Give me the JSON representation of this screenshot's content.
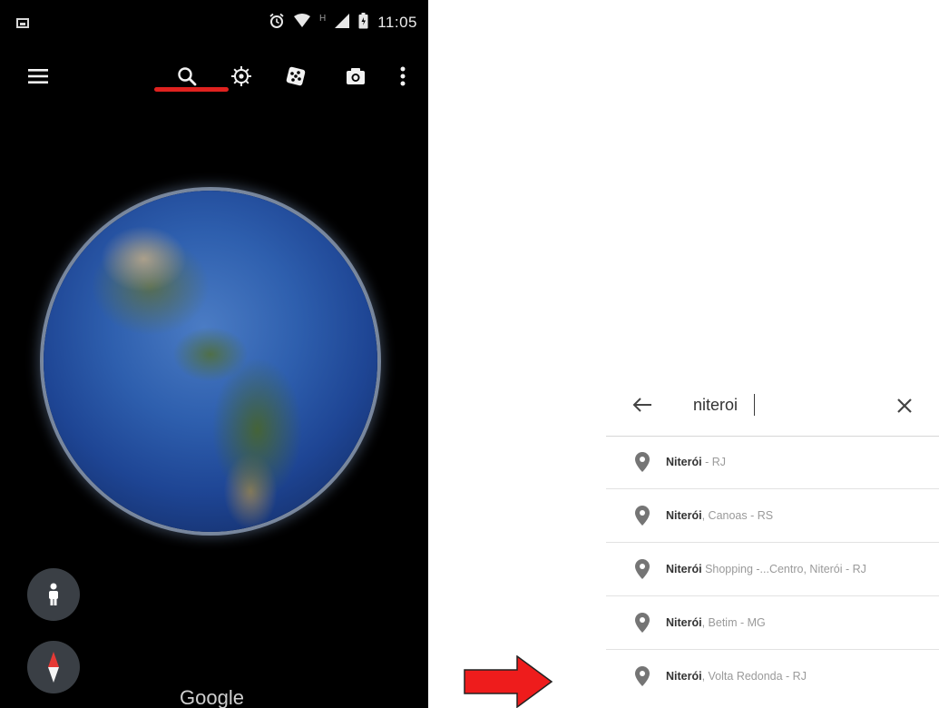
{
  "status_bar": {
    "time": "11:05",
    "network_letter": "H"
  },
  "toolbar": {
    "icons": [
      "menu-icon",
      "search-icon",
      "voyager-icon",
      "dice-icon",
      "camera-icon",
      "more-vert-icon"
    ]
  },
  "map": {
    "logo_text": "Google"
  },
  "search": {
    "query": "niteroi",
    "results": [
      {
        "bold": "Niterói",
        "rest": " - RJ"
      },
      {
        "bold": "Niterói",
        "rest": ", Canoas - RS"
      },
      {
        "bold": "Niterói",
        "rest": " Shopping -...Centro, Niterói - RJ"
      },
      {
        "bold": "Niterói",
        "rest": ", Betim - MG"
      },
      {
        "bold": "Niterói",
        "rest": ", Volta Redonda - RJ"
      }
    ]
  },
  "colors": {
    "highlight": "#e0221f",
    "arrow": "#ee1c1c",
    "pin": "#757575"
  }
}
